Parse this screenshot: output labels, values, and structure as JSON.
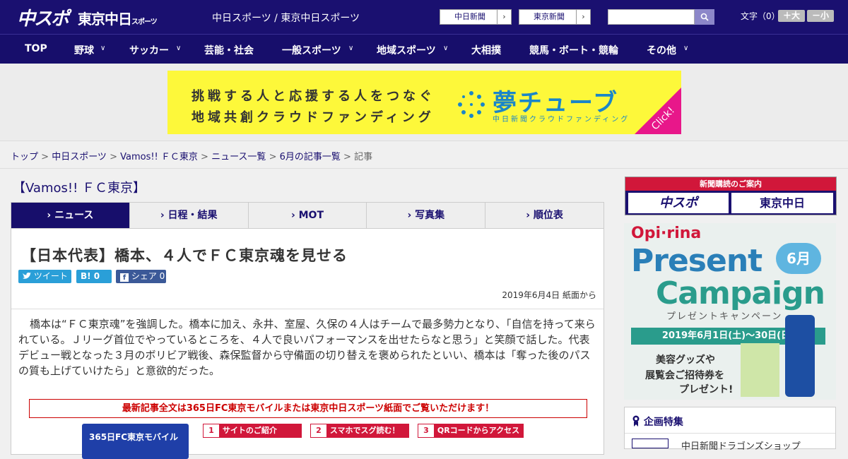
{
  "header": {
    "logo_main": "中スポ",
    "logo_sub": "東京中日",
    "logo_sub_small": "スポーツ",
    "site_title": "中日スポーツ / 東京中日スポーツ",
    "btn_chunichi": "中日新聞",
    "btn_tokyo": "東京新聞",
    "btn_arrow": "›",
    "search_placeholder": "",
    "font_label": "文字（0）",
    "font_bigger": "＋大",
    "font_smaller": "－小"
  },
  "nav": {
    "items": [
      "TOP",
      "野球",
      "サッカー",
      "芸能・社会",
      "一般スポーツ",
      "地域スポーツ",
      "大相撲",
      "競馬・ボート・競輪",
      "その他"
    ],
    "chevron": "∨"
  },
  "ad": {
    "line1": "挑戦する人と応援する人をつなぐ",
    "line2": "地域共創クラウドファンディング",
    "brand": "夢チューブ",
    "brand_sub": "中日新聞クラウドファンディング",
    "click": "Click!"
  },
  "breadcrumb": {
    "items": [
      "トップ",
      "中日スポーツ",
      "Vamos!! ＦＣ東京",
      "ニュース一覧",
      "6月の記事一覧"
    ],
    "current": "記事",
    "sep": " > "
  },
  "section_title": "【Vamos!! ＦＣ東京】",
  "tabs": [
    {
      "label": "› ニュース"
    },
    {
      "label": "› 日程・結果"
    },
    {
      "label": "› MOT"
    },
    {
      "label": "› 写真集"
    },
    {
      "label": "› 順位表"
    }
  ],
  "article": {
    "title": "【日本代表】橋本、４人でＦＣ東京魂を見せる",
    "share_tweet": "ツイート",
    "share_hatena": "B! 0",
    "share_facebook": "シェア 0",
    "date": "2019年6月4日 紙面から",
    "body": "橋本は“ＦＣ東京魂”を強調した。橋本に加え、永井、室屋、久保の４人はチームで最多勢力となり、「自信を持って来られている。Ｊリーグ首位でやっているところを、４人で良いパフォーマンスを出せたらなと思う」と笑顔で話した。代表デビュー戦となった３月のボリビア戦後、森保監督から守備面の切り替えを褒められたといい、橋本は「奪った後のパスの質も上げていけたら」と意欲的だった。",
    "notice": "最新記事全文は365日FC東京モバイルまたは東京中日スポーツ紙面でご覧いただけます！",
    "promo_title": "365日FC東京モバイル",
    "steps": [
      {
        "num": "1",
        "label": "サイトのご紹介"
      },
      {
        "num": "2",
        "label": "スマホでスグ読む！"
      },
      {
        "num": "3",
        "label": "QRコードからアクセス"
      }
    ]
  },
  "sidebar": {
    "subscribe_label": "新聞購読のご案内",
    "sub_logo1": "中スポ",
    "sub_logo2": "東京中日",
    "campaign_brand": "Opi·rina",
    "campaign_title1": "Present",
    "campaign_title2": "Campaign",
    "campaign_month": "6月",
    "campaign_kana": "プレゼントキャンペーン",
    "campaign_date": "2019年6月1日(土)〜30日(日)",
    "campaign_text1": "美容グッズや",
    "campaign_text2": "展覧会ご招待券を",
    "campaign_text3": "プレゼント!",
    "feature_heading": "企画特集",
    "feature_item": "中日新聞ドラゴンズショップ"
  },
  "colors": {
    "brand": "#1a1070",
    "accent": "#d1173a",
    "twitter": "#2a9fd8",
    "hatena": "#2a9fd8",
    "facebook": "#3b5998"
  }
}
